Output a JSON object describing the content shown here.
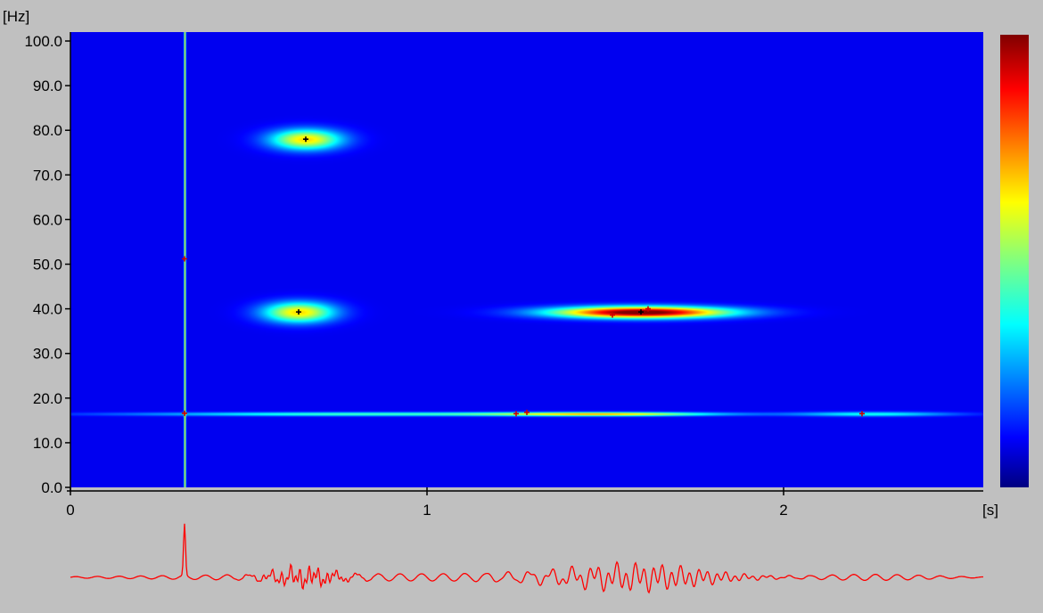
{
  "chart_data": {
    "type": "heatmap",
    "title": "",
    "xlabel": "[s]",
    "ylabel": "[Hz]",
    "x_ticks": [
      "0",
      "1",
      "2"
    ],
    "y_ticks": [
      "0.0",
      "10.0",
      "20.0",
      "30.0",
      "40.0",
      "50.0",
      "60.0",
      "70.0",
      "80.0",
      "90.0",
      "100.0"
    ],
    "xlim": [
      0,
      2.56
    ],
    "ylim": [
      0,
      102
    ],
    "colormap": "jet",
    "colorbar": true,
    "colors": {
      "background": "#000080",
      "signal": "#ff0000",
      "page": "#c0c0c0"
    },
    "atoms": [
      {
        "t": 0.66,
        "f": 78,
        "width_s": 0.07,
        "width_hz": 1.6,
        "intensity": 0.55
      },
      {
        "t": 0.64,
        "f": 39.3,
        "width_s": 0.07,
        "width_hz": 1.6,
        "intensity": 0.55
      },
      {
        "t": 1.6,
        "f": 39.3,
        "width_s": 0.17,
        "width_hz": 0.9,
        "intensity": 0.95
      },
      {
        "t": 0.8,
        "f": 16.5,
        "width_s": 0.45,
        "width_hz": 0.3,
        "intensity": 0.33
      },
      {
        "t": 1.5,
        "f": 16.5,
        "width_s": 0.22,
        "width_hz": 0.3,
        "intensity": 0.5
      },
      {
        "t": 2.25,
        "f": 16.5,
        "width_s": 0.16,
        "width_hz": 0.35,
        "intensity": 0.28
      }
    ],
    "impulse": {
      "t": 0.32,
      "intensity": 0.55
    },
    "markers": [
      {
        "t": 0.66,
        "f": 78,
        "color": "#000000"
      },
      {
        "t": 0.64,
        "f": 39.3,
        "color": "#000000"
      },
      {
        "t": 0.32,
        "f": 51.2,
        "color": "#cc0000"
      },
      {
        "t": 0.32,
        "f": 16.6,
        "color": "#cc0000"
      },
      {
        "t": 1.52,
        "f": 38.6,
        "color": "#cc0000"
      },
      {
        "t": 1.6,
        "f": 39.3,
        "color": "#000000"
      },
      {
        "t": 1.62,
        "f": 40,
        "color": "#cc0000"
      },
      {
        "t": 1.25,
        "f": 16.5,
        "color": "#cc0000"
      },
      {
        "t": 1.28,
        "f": 16.8,
        "color": "#cc0000"
      },
      {
        "t": 2.22,
        "f": 16.5,
        "color": "#cc0000"
      }
    ]
  }
}
